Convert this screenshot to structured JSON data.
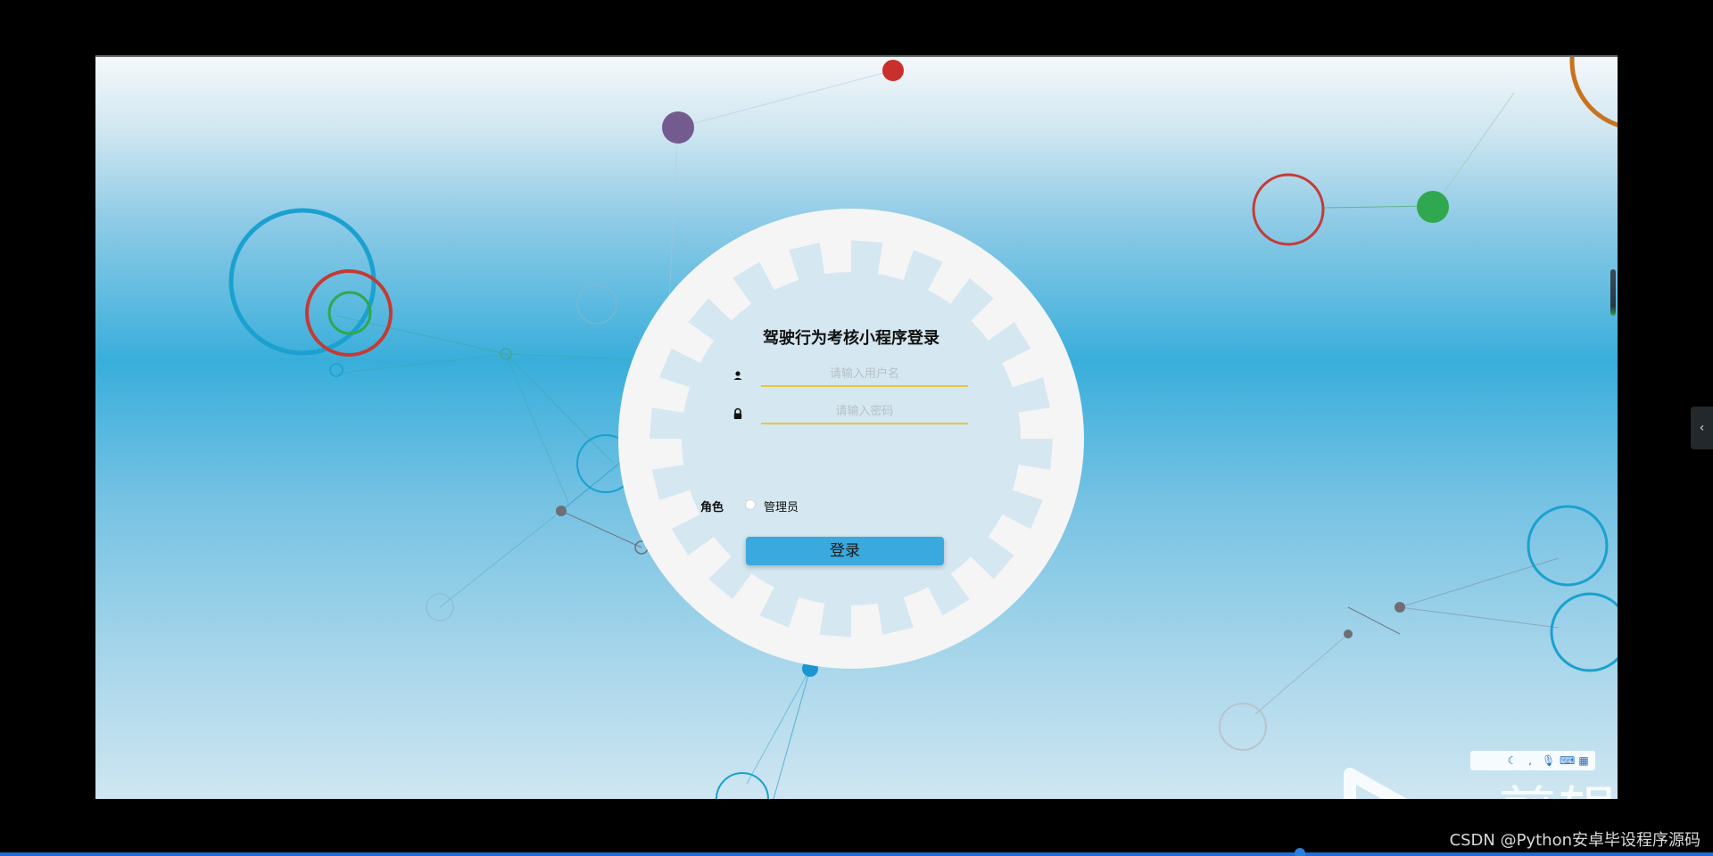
{
  "login": {
    "title": "驾驶行为考核小程序登录",
    "username_placeholder": "请输入用户名",
    "password_placeholder": "请输入密码",
    "role_label": "角色",
    "role_option": "管理员",
    "submit_label": "登录"
  },
  "icons": {
    "user": "user-icon",
    "lock": "lock-icon",
    "side_toggle": "chevron-left-icon",
    "ime": [
      "moon-icon",
      "comma-icon",
      "microphone-icon",
      "keyboard-icon",
      "grid-icon"
    ]
  },
  "side_toggle_glyph": "‹",
  "watermark": {
    "text": "ev剪辑"
  },
  "caption": "CSDN @Python安卓毕设程序源码",
  "colors": {
    "accent": "#3aa9dd",
    "input_underline": "#e7c83c",
    "card": "#f5f5f5",
    "card_inner": "#d5e7f1"
  }
}
